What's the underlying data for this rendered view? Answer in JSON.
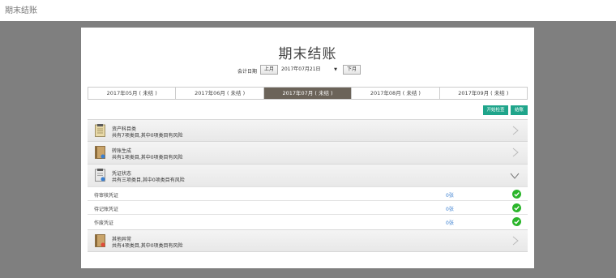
{
  "topbar": {
    "title": "期末结账"
  },
  "page": {
    "title": "期末结账"
  },
  "date": {
    "label": "会计日期",
    "prev_label": "上月",
    "value": "2017年07月21日",
    "next_label": "下月"
  },
  "tabs": [
    {
      "label": "2017年05月 ( 未结 )"
    },
    {
      "label": "2017年06月 ( 未结 )"
    },
    {
      "label": "2017年07月 ( 未结 )"
    },
    {
      "label": "2017年08月 ( 未结 )"
    },
    {
      "label": "2017年09月 ( 未结 )"
    }
  ],
  "actions": {
    "check_label": "开始检查",
    "close_label": "结账"
  },
  "sections": [
    {
      "title": "资产科目类",
      "sub": "共有7项类目,其中0项类目有风险",
      "icon": "notebook-icon"
    },
    {
      "title": "转账生成",
      "sub": "共有1项类目,其中0项类目有风险",
      "icon": "book-icon"
    },
    {
      "title": "凭证状态",
      "sub": "共有三项类目,其中0项类目有风险",
      "icon": "notebook-icon"
    },
    {
      "title": "其他异常",
      "sub": "共有4项类目,其中0项类目有风险",
      "icon": "book-warning-icon"
    }
  ],
  "voucher_items": [
    {
      "label": "待审核凭证",
      "status": "0张"
    },
    {
      "label": "待记账凭证",
      "status": "0张"
    },
    {
      "label": "作废凭证",
      "status": "0张"
    }
  ],
  "colors": {
    "active_tab": "#6b6359",
    "action_button": "#1fa58b",
    "ok_check": "#2ab52a",
    "link": "#3a7fd0"
  }
}
